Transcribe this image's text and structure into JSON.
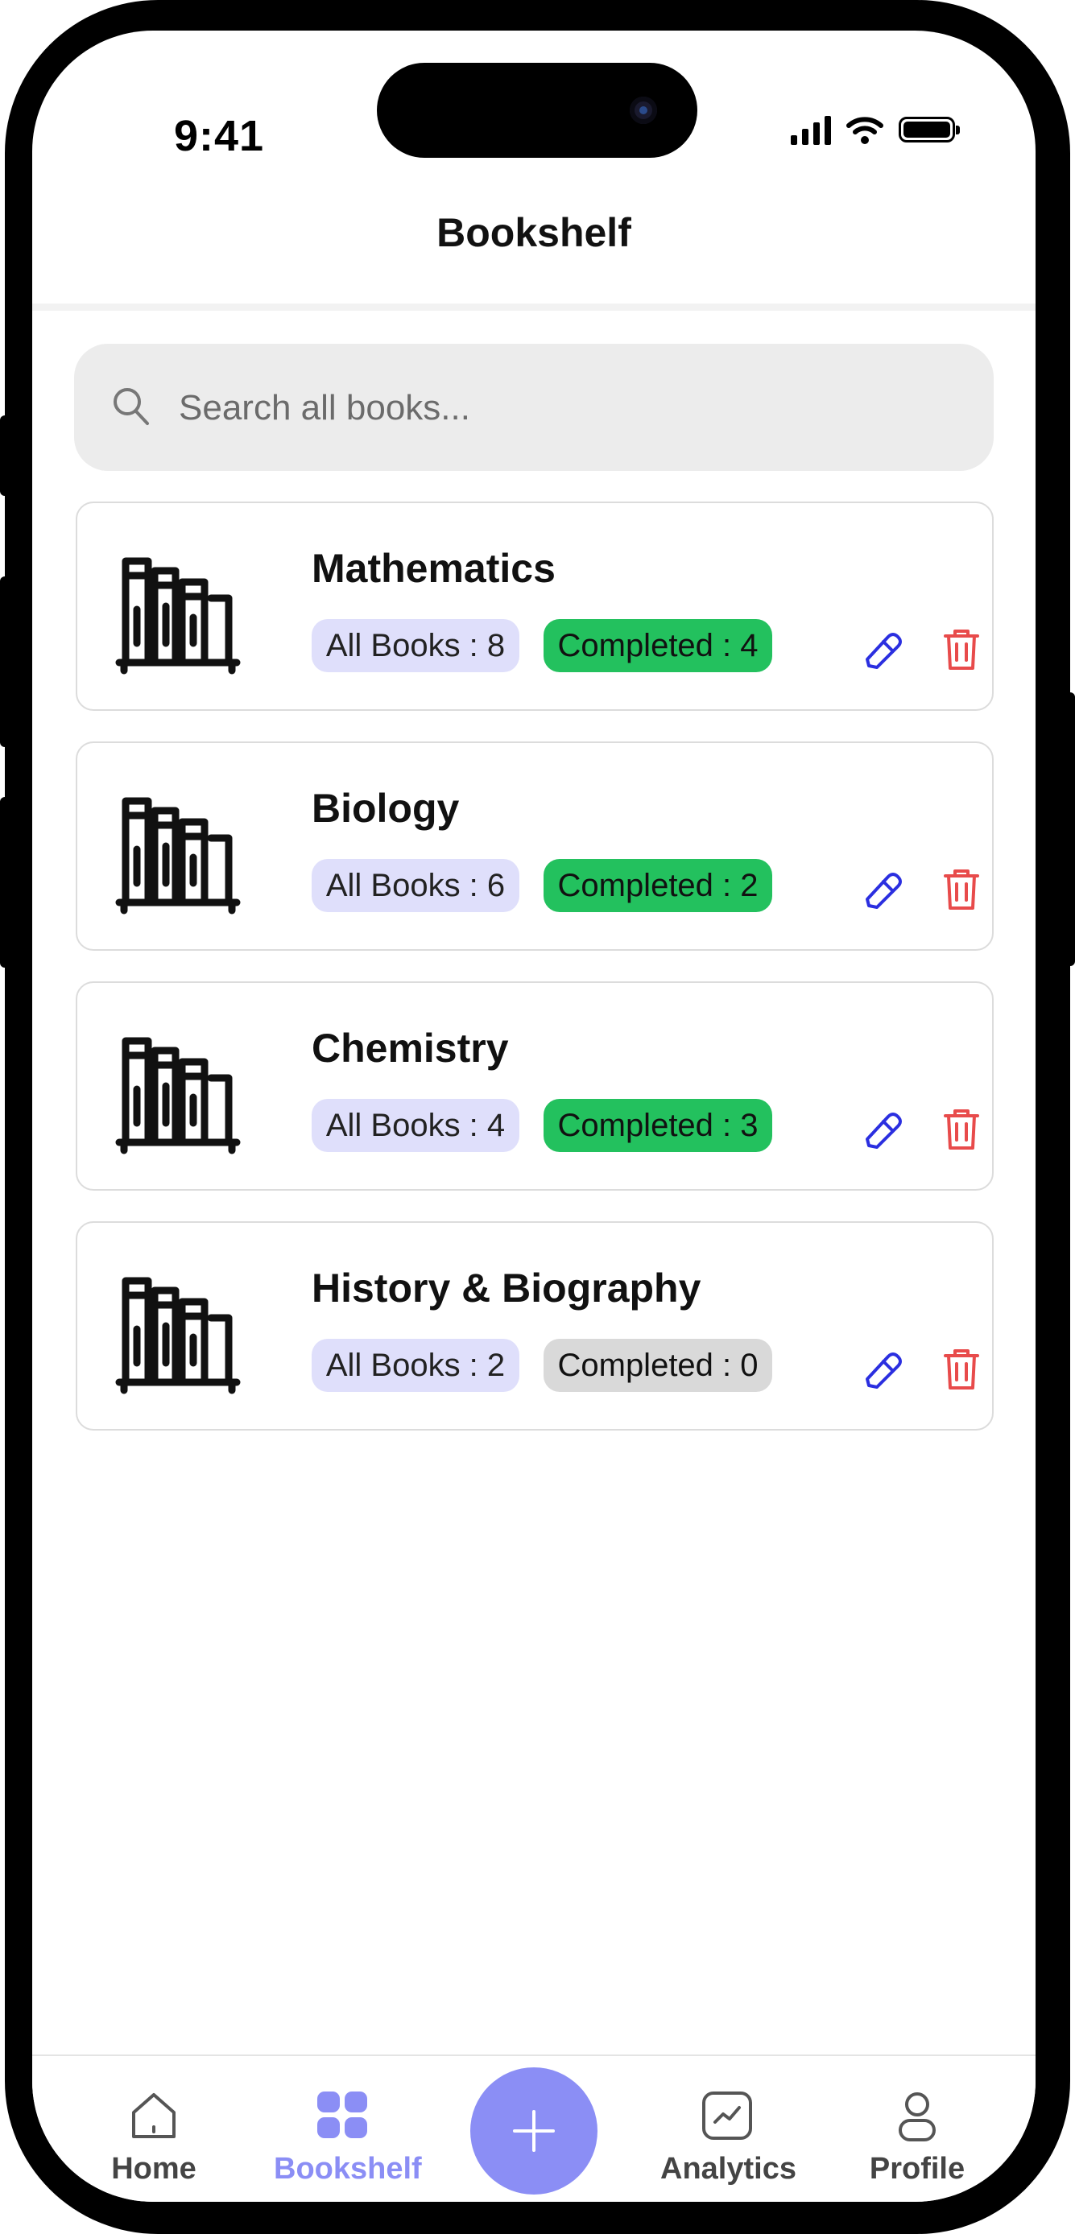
{
  "status_bar": {
    "time": "9:41"
  },
  "header": {
    "title": "Bookshelf"
  },
  "search": {
    "placeholder": "Search all books..."
  },
  "categories": [
    {
      "name": "Mathematics",
      "all_books": "All Books : 8",
      "completed": "Completed : 4",
      "completed_status": "green"
    },
    {
      "name": "Biology",
      "all_books": "All Books : 6",
      "completed": "Completed : 2",
      "completed_status": "green"
    },
    {
      "name": "Chemistry",
      "all_books": "All Books : 4",
      "completed": "Completed : 3",
      "completed_status": "green"
    },
    {
      "name": "History & Biography",
      "all_books": "All Books : 2",
      "completed": "Completed : 0",
      "completed_status": "grey"
    }
  ],
  "nav": {
    "home": "Home",
    "bookshelf": "Bookshelf",
    "analytics": "Analytics",
    "profile": "Profile",
    "active": "bookshelf"
  },
  "colors": {
    "accent": "#8b8ef5",
    "all_badge": "#dfdffb",
    "completed_green": "#23c15e",
    "completed_grey": "#d9d9d9",
    "edit": "#2b2fe0",
    "delete": "#e84b4b"
  },
  "icons": [
    "search-icon",
    "bookshelf-icon",
    "pencil-icon",
    "trash-icon",
    "home-icon",
    "grid-icon",
    "plus-icon",
    "analytics-icon",
    "person-icon"
  ]
}
